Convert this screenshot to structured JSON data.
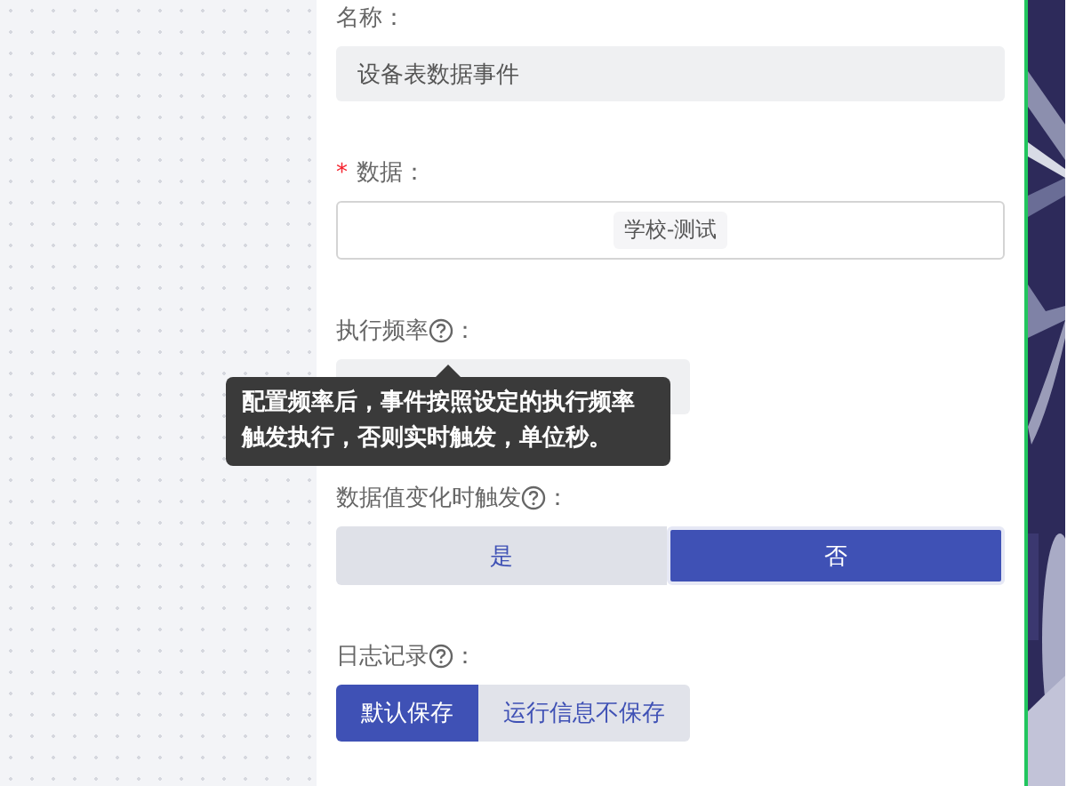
{
  "form": {
    "fields": [
      {
        "label": "名称",
        "colon": "：",
        "help": false,
        "kind": "input",
        "value": "设备表数据事件"
      },
      {
        "label": "数据",
        "required_mark": "*",
        "colon": "：",
        "help": false,
        "kind": "tag-input",
        "value": "学校-测试"
      },
      {
        "label": "执行频率",
        "colon": "：",
        "help": true,
        "kind": "short-input"
      },
      {
        "label": "数据值变化时触发",
        "colon": "：",
        "help": true,
        "kind": "segmented",
        "options": [
          {
            "label": "是",
            "selected": false
          },
          {
            "label": "否",
            "selected": true
          }
        ]
      },
      {
        "label": "日志记录",
        "colon": "：",
        "help": true,
        "kind": "buttons",
        "options": [
          {
            "label": "默认保存",
            "selected": true
          },
          {
            "label": "运行信息不保存",
            "selected": false
          }
        ]
      }
    ]
  },
  "tooltip": {
    "text": "配置频率后，事件按照设定的执行频率触发执行，否则实时触发，单位秒。"
  }
}
